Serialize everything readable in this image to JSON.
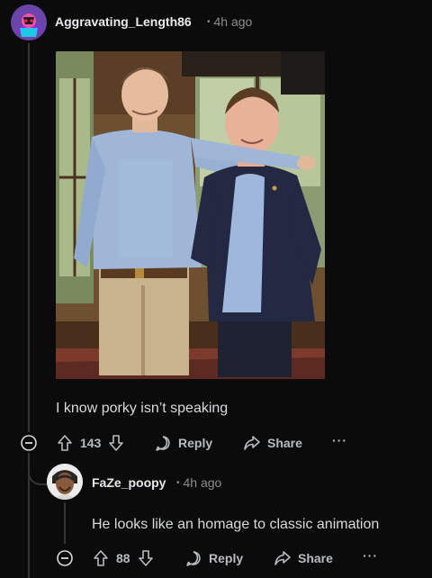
{
  "comments": [
    {
      "username": "Aggravating_Length86",
      "separator": "•",
      "time": "4h ago",
      "body": "I know porky isn’t speaking",
      "votes": "143",
      "reply_label": "Reply",
      "share_label": "Share",
      "more_label": "···"
    },
    {
      "username": "FaZe_poopy",
      "separator": "•",
      "time": "4h ago",
      "body": "He looks like an homage to classic animation",
      "votes": "88",
      "reply_label": "Reply",
      "share_label": "Share",
      "more_label": "···"
    }
  ],
  "colors": {
    "background": "#0b0b0c",
    "text": "#d7dadc",
    "muted": "#8a8d90",
    "thread_line": "#343536"
  },
  "icons": [
    "user-avatar-icon",
    "collapse-icon",
    "upvote-icon",
    "downvote-icon",
    "reply-icon",
    "share-icon",
    "more-icon"
  ]
}
